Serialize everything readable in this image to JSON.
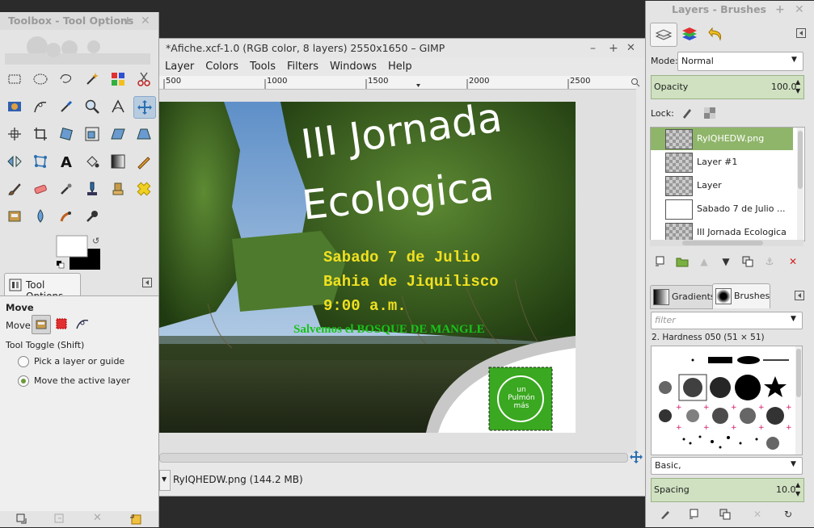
{
  "toolbox": {
    "title": "Toolbox - Tool Options",
    "tools": [
      "rect-select",
      "ellipse-select",
      "free-select",
      "fuzzy-select",
      "select-by-color",
      "scissors",
      "foreground-select",
      "paths",
      "color-picker",
      "zoom",
      "measure",
      "move",
      "align",
      "crop",
      "rotate",
      "scale",
      "shear",
      "perspective",
      "flip",
      "cage-transform",
      "text",
      "bucket-fill",
      "blend",
      "pencil",
      "paintbrush",
      "eraser",
      "airbrush",
      "ink",
      "clone",
      "heal",
      "perspective-clone",
      "blur",
      "smudge",
      "dodge-burn"
    ],
    "tool_options_tab": "Tool Options",
    "section_title": "Move",
    "move_label": "Move:",
    "toggle_label": "Tool Toggle  (Shift)",
    "options": [
      "Pick a layer or guide",
      "Move the active layer"
    ],
    "selected_option": 1
  },
  "image_window": {
    "title": "*Afiche.xcf-1.0 (RGB color, 8 layers) 2550x1650 – GIMP",
    "menu": [
      "Layer",
      "Colors",
      "Tools",
      "Filters",
      "Windows",
      "Help"
    ],
    "ruler_ticks": [
      "500",
      "1000",
      "1500",
      "2000",
      "2500"
    ],
    "status_layer": "RyIQHEDW.png (144.2 MB)"
  },
  "poster": {
    "title_line1": "III Jornada",
    "title_line2": "Ecologica",
    "line1": "Sabado 7 de Julio",
    "line2": "Bahia de Jiquilisco",
    "line3": "9:00 a.m.",
    "slogan": "Salvemos el BOSQUE DE MANGLE",
    "logo_line1": "un",
    "logo_line2": "Pulmón",
    "logo_line3": "más"
  },
  "layers_dock": {
    "title": "Layers - Brushes",
    "mode_label": "Mode:",
    "mode_value": "Normal",
    "opacity_label": "Opacity",
    "opacity_value": "100.0",
    "lock_label": "Lock:",
    "layers": [
      "RyIQHEDW.png",
      "Layer #1",
      "Layer",
      "Sabado 7 de Julio ...",
      "III Jornada Ecologica"
    ],
    "selected_layer": 0,
    "tab_gradients": "Gradients",
    "tab_brushes": "Brushes",
    "filter_placeholder": "filter",
    "brush_info": "2. Hardness 050 (51 × 51)",
    "brush_set": "Basic,",
    "spacing_label": "Spacing",
    "spacing_value": "10.0"
  },
  "colors": {
    "selected_layer_bg": "#8fb56a",
    "poster_yellow": "#f0e020",
    "poster_green": "#19c21a",
    "logo_green": "#3aa820"
  }
}
